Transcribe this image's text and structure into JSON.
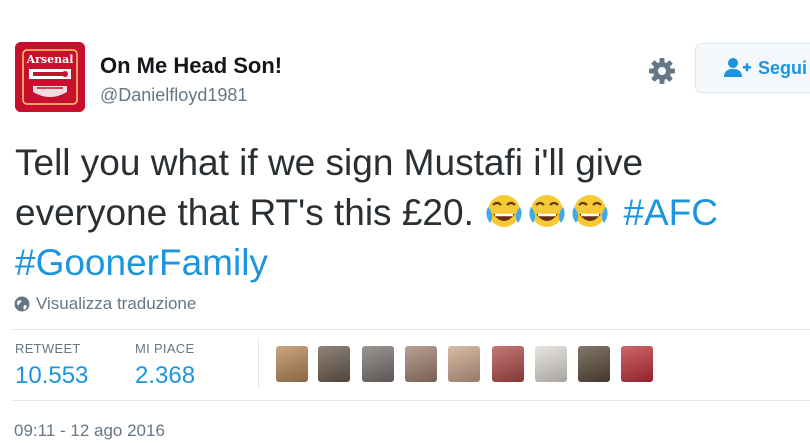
{
  "user": {
    "display_name": "On Me Head Son!",
    "handle": "@Danielfloyd1981",
    "avatar_text": "Arsenal"
  },
  "actions": {
    "follow_label": "Segui"
  },
  "tweet": {
    "line1": "Tell you what if we sign Mustafi i'll give",
    "line2_text": "everyone that RT's this £20.",
    "hashtag1": "#AFC",
    "hashtag2": "#GoonerFamily",
    "emoji": "face-with-tears-of-joy",
    "emoji_count": 3
  },
  "translate_label": "Visualizza traduzione",
  "stats": {
    "retweets_label": "RETWEET",
    "retweets_value": "10.553",
    "likes_label": "MI PIACE",
    "likes_value": "2.368"
  },
  "likers": [
    {
      "color": "#b8865a"
    },
    {
      "color": "#6b5a4e"
    },
    {
      "color": "#7a7370"
    },
    {
      "color": "#a08070"
    },
    {
      "color": "#c9a48a"
    },
    {
      "color": "#b04a4a"
    },
    {
      "color": "#e0dcd6"
    },
    {
      "color": "#5a4a3a"
    },
    {
      "color": "#c0303a"
    }
  ],
  "timestamp": "09:11 - 12 ago 2016",
  "colors": {
    "link": "#1b95e0",
    "muted": "#657786",
    "text": "#292f33",
    "avatar_red": "#c8102e"
  }
}
